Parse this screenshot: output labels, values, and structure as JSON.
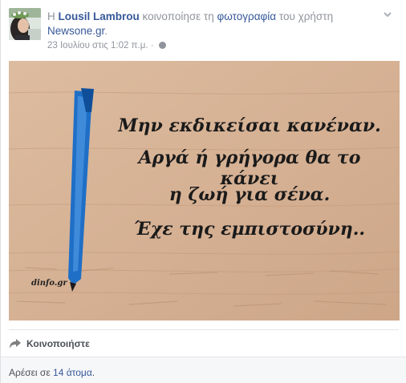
{
  "post": {
    "prefix": "Η",
    "author": "Lousil Lambrou",
    "action": "κοινοποίησε τη",
    "object": "φωτογραφία",
    "connector": "του χρήστη",
    "source": "Newsone.gr",
    "source_suffix": ".",
    "timestamp": "23 Ιουλίου στις 1:02 π.μ.",
    "separator": "·",
    "privacy_icon": "globe-icon",
    "menu_icon": "chevron-down-icon"
  },
  "image": {
    "lines": [
      "Μην εκδικείσαι κανέναν.",
      "Αργά ή γρήγορα θα το κάνει",
      "η ζωή για σένα.",
      "Έχε της εμπιστοσύνη.."
    ],
    "watermark": "dinfo.gr",
    "pen_color": "#1f6fc7",
    "background_color": "#d9b89a"
  },
  "actions": {
    "share_label": "Κοινοποιήστε",
    "share_icon": "share-arrow-icon"
  },
  "likes": {
    "prefix": "Αρέσει σε",
    "count_text": "14 άτομα",
    "suffix": "."
  },
  "colors": {
    "link": "#365899",
    "muted": "#90949c"
  }
}
